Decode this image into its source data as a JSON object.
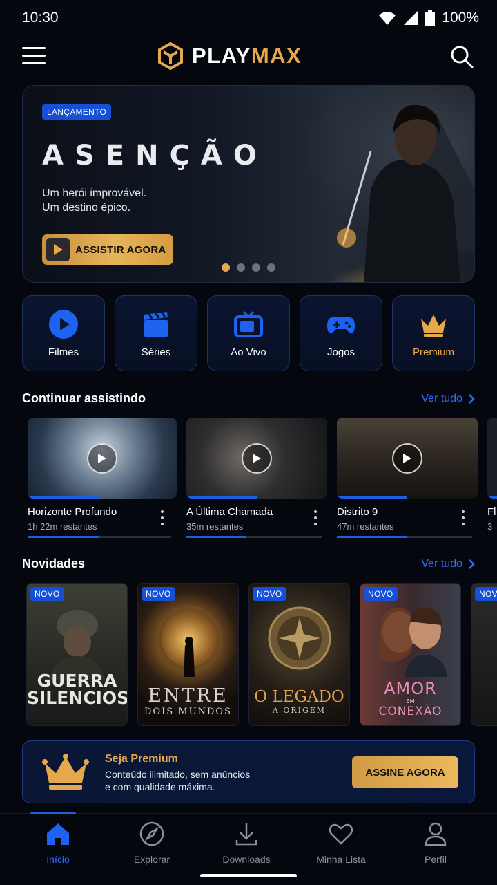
{
  "status_bar": {
    "time": "10:30",
    "battery": "100%"
  },
  "header": {
    "logo_play": "PLAY",
    "logo_max": "MAX"
  },
  "hero": {
    "badge": "LANÇAMENTO",
    "title": "ASENÇÃO",
    "subtitle_line1": "Um herói improvável.",
    "subtitle_line2": "Um destino épico.",
    "cta": "ASSISTIR AGORA",
    "slides": 4,
    "active_slide": 1
  },
  "categories": [
    {
      "label": "Filmes",
      "icon": "play-circle-icon"
    },
    {
      "label": "Séries",
      "icon": "clapperboard-icon"
    },
    {
      "label": "Ao Vivo",
      "icon": "tv-icon"
    },
    {
      "label": "Jogos",
      "icon": "gamepad-icon"
    },
    {
      "label": "Premium",
      "icon": "crown-icon"
    }
  ],
  "continue_watching": {
    "title": "Continuar assistindo",
    "see_all": "Ver tudo",
    "items": [
      {
        "title": "Horizonte Profundo",
        "remaining": "1h 22m restantes",
        "progress": 0.5
      },
      {
        "title": "A Última Chamada",
        "remaining": "35m restantes",
        "progress": 0.5
      },
      {
        "title": "Distrito 9",
        "remaining": "47m restantes",
        "progress": 0.5
      },
      {
        "title": "Fl",
        "remaining": "3",
        "progress": 0.5
      }
    ]
  },
  "novidades": {
    "title": "Novidades",
    "see_all": "Ver tudo",
    "badge": "NOVO",
    "items": [
      {
        "title_line1": "GUERRA",
        "title_line2": "SILENCIOSA"
      },
      {
        "title_line1": "ENTRE",
        "title_line2": "DOIS MUNDOS"
      },
      {
        "title_line1": "O LEGADO",
        "title_line2": "A ORIGEM"
      },
      {
        "title_line1": "AMOR",
        "title_mid": "EM",
        "title_line2": "CONEXÃO"
      }
    ]
  },
  "premium": {
    "title": "Seja Premium",
    "desc_line1": "Conteúdo ilimitado, sem anúncios",
    "desc_line2": "e com qualidade máxima.",
    "cta": "ASSINE AGORA"
  },
  "bottom_nav": [
    {
      "label": "Início",
      "icon": "home-icon",
      "active": true
    },
    {
      "label": "Explorar",
      "icon": "compass-icon",
      "active": false
    },
    {
      "label": "Downloads",
      "icon": "download-icon",
      "active": false
    },
    {
      "label": "Minha Lista",
      "icon": "heart-icon",
      "active": false
    },
    {
      "label": "Perfil",
      "icon": "user-icon",
      "active": false
    }
  ],
  "colors": {
    "accent": "#1d5fe0",
    "gold": "#e5a94c",
    "background": "#05070e"
  }
}
